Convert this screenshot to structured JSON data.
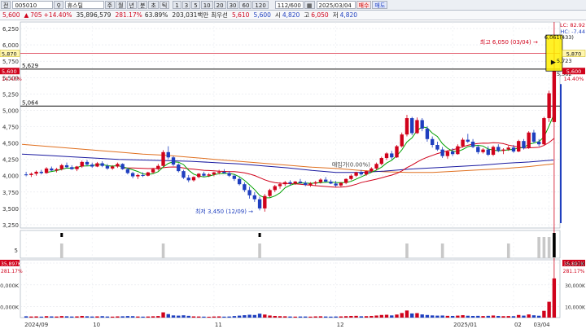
{
  "toolbar": {
    "period_label": "전",
    "code": "005010",
    "name": "휴스틸",
    "timeframes": [
      "주",
      "월",
      "년",
      "분",
      "초",
      "틱"
    ],
    "minute_steps": [
      "1",
      "3",
      "5",
      "10",
      "20",
      "30",
      "60",
      "120"
    ],
    "count": "112/600",
    "date": "2025/03/04",
    "buy_label": "매수",
    "sell_label": "매도"
  },
  "quote": {
    "price": "5,600",
    "change": "705",
    "change_pct": "+14.40%",
    "volume": "35,896,579",
    "vol_ratio": "281.17%",
    "turnover": "63.89%",
    "amount": "203,031백만",
    "priority_label": "최우선",
    "bid": "5,610",
    "ask": "5,600",
    "open_label": "시",
    "open": "4,820",
    "high_label": "고",
    "high": "6,050",
    "low_label": "저",
    "low": "4,820"
  },
  "colors": {
    "up": "#d0021b",
    "down": "#1f3fbf",
    "ma5": "#00a000",
    "ma20": "#d0021b",
    "ma60": "#1a1aa0",
    "ma120": "#e07020",
    "crosshair": "#d0021b",
    "highlight": "#ffee00"
  },
  "chart_data": {
    "type": "candlestick",
    "price_axis": {
      "ticks": [
        "6,250",
        "6,000",
        "5,750",
        "5,500",
        "5,250",
        "5,000",
        "4,750",
        "4,500",
        "4,250",
        "4,000",
        "3,750",
        "3,500",
        "3,250"
      ],
      "min": 3200,
      "max": 6350
    },
    "right_axis_labels": {
      "lc": "LC: 82.92",
      "hc": "HC: -7.44",
      "top_value": "5,870",
      "current_price": "5,600",
      "current_pct": "14.40%"
    },
    "left_axis_labels": {
      "top_value": "5,870",
      "current_price": "5,600",
      "current_pct": "14.40%"
    },
    "ref_lines": [
      {
        "label": "5,629",
        "value": 5629
      },
      {
        "label": "5,064",
        "value": 5064
      }
    ],
    "highs_marker": {
      "label": "최고 6,050 (03/04)",
      "value": 6050
    },
    "lows_marker": {
      "label": "최저 3,450 (12/09)",
      "value": 3450
    },
    "mid_annotation": "매입가(0.00%)",
    "magnifier_values": {
      "top": "6,061(433)",
      "mid": "5,723",
      "low": "5,562"
    },
    "candles": [
      [
        4020,
        4060,
        3990,
        4010
      ],
      [
        4010,
        4050,
        3980,
        4030
      ],
      [
        4030,
        4080,
        4000,
        4060
      ],
      [
        4060,
        4090,
        4020,
        4040
      ],
      [
        4040,
        4130,
        4030,
        4110
      ],
      [
        4110,
        4140,
        4070,
        4080
      ],
      [
        4080,
        4120,
        4050,
        4100
      ],
      [
        4100,
        4180,
        4080,
        4160
      ],
      [
        4160,
        4200,
        4110,
        4130
      ],
      [
        4130,
        4160,
        4090,
        4100
      ],
      [
        4100,
        4150,
        4070,
        4140
      ],
      [
        4140,
        4230,
        4120,
        4210
      ],
      [
        4210,
        4240,
        4150,
        4170
      ],
      [
        4170,
        4200,
        4120,
        4140
      ],
      [
        4140,
        4210,
        4130,
        4190
      ],
      [
        4190,
        4220,
        4130,
        4150
      ],
      [
        4150,
        4180,
        4090,
        4110
      ],
      [
        4110,
        4160,
        4090,
        4140
      ],
      [
        4140,
        4200,
        4120,
        4180
      ],
      [
        4180,
        4190,
        4090,
        4100
      ],
      [
        4100,
        4120,
        4020,
        4040
      ],
      [
        4040,
        4060,
        3960,
        3990
      ],
      [
        3990,
        4030,
        3950,
        4010
      ],
      [
        4010,
        4050,
        3980,
        4000
      ],
      [
        4000,
        4060,
        3990,
        4050
      ],
      [
        4050,
        4120,
        4030,
        4100
      ],
      [
        4100,
        4180,
        4080,
        4150
      ],
      [
        4150,
        4390,
        4140,
        4360
      ],
      [
        4360,
        4450,
        4250,
        4280
      ],
      [
        4280,
        4300,
        4150,
        4170
      ],
      [
        4170,
        4190,
        4050,
        4070
      ],
      [
        4070,
        4090,
        3950,
        3970
      ],
      [
        3970,
        4010,
        3900,
        3930
      ],
      [
        3930,
        3990,
        3910,
        3980
      ],
      [
        3980,
        4040,
        3960,
        4030
      ],
      [
        4030,
        4060,
        3980,
        4000
      ],
      [
        4000,
        4040,
        3980,
        4020
      ],
      [
        4020,
        4060,
        3990,
        4050
      ],
      [
        4050,
        4090,
        4020,
        4060
      ],
      [
        4060,
        4100,
        4030,
        4040
      ],
      [
        4040,
        4070,
        3980,
        4000
      ],
      [
        4000,
        4020,
        3920,
        3950
      ],
      [
        3950,
        3980,
        3850,
        3870
      ],
      [
        3870,
        3900,
        3750,
        3780
      ],
      [
        3780,
        3830,
        3650,
        3700
      ],
      [
        3700,
        3750,
        3600,
        3640
      ],
      [
        3640,
        3680,
        3470,
        3500
      ],
      [
        3500,
        3720,
        3450,
        3690
      ],
      [
        3690,
        3800,
        3670,
        3780
      ],
      [
        3780,
        3860,
        3750,
        3840
      ],
      [
        3840,
        3900,
        3800,
        3870
      ],
      [
        3870,
        3920,
        3840,
        3900
      ],
      [
        3900,
        3930,
        3850,
        3880
      ],
      [
        3880,
        3920,
        3860,
        3910
      ],
      [
        3910,
        3950,
        3880,
        3890
      ],
      [
        3890,
        3920,
        3840,
        3860
      ],
      [
        3860,
        3900,
        3830,
        3880
      ],
      [
        3880,
        3920,
        3850,
        3900
      ],
      [
        3900,
        3960,
        3880,
        3940
      ],
      [
        3940,
        3980,
        3900,
        3910
      ],
      [
        3910,
        3940,
        3870,
        3880
      ],
      [
        3880,
        3920,
        3830,
        3850
      ],
      [
        3850,
        3900,
        3830,
        3890
      ],
      [
        3890,
        3960,
        3870,
        3950
      ],
      [
        3950,
        4020,
        3930,
        4000
      ],
      [
        4000,
        4060,
        3980,
        4050
      ],
      [
        4050,
        4090,
        4000,
        4020
      ],
      [
        4020,
        4080,
        4000,
        4070
      ],
      [
        4070,
        4130,
        4050,
        4110
      ],
      [
        4110,
        4200,
        4090,
        4180
      ],
      [
        4180,
        4290,
        4160,
        4270
      ],
      [
        4270,
        4360,
        4240,
        4340
      ],
      [
        4340,
        4380,
        4250,
        4280
      ],
      [
        4280,
        4470,
        4270,
        4450
      ],
      [
        4450,
        4660,
        4430,
        4630
      ],
      [
        4630,
        4930,
        4600,
        4880
      ],
      [
        4880,
        4900,
        4620,
        4650
      ],
      [
        4650,
        4890,
        4640,
        4850
      ],
      [
        4850,
        4880,
        4680,
        4720
      ],
      [
        4720,
        4760,
        4520,
        4560
      ],
      [
        4560,
        4600,
        4430,
        4470
      ],
      [
        4470,
        4520,
        4380,
        4400
      ],
      [
        4400,
        4440,
        4270,
        4300
      ],
      [
        4300,
        4390,
        4260,
        4370
      ],
      [
        4370,
        4420,
        4300,
        4330
      ],
      [
        4330,
        4480,
        4320,
        4450
      ],
      [
        4450,
        4580,
        4430,
        4550
      ],
      [
        4550,
        4640,
        4500,
        4520
      ],
      [
        4520,
        4560,
        4420,
        4440
      ],
      [
        4440,
        4470,
        4330,
        4360
      ],
      [
        4360,
        4420,
        4340,
        4400
      ],
      [
        4400,
        4450,
        4300,
        4320
      ],
      [
        4320,
        4460,
        4300,
        4440
      ],
      [
        4440,
        4480,
        4360,
        4380
      ],
      [
        4380,
        4420,
        4330,
        4400
      ],
      [
        4400,
        4460,
        4380,
        4430
      ],
      [
        4430,
        4470,
        4350,
        4370
      ],
      [
        4370,
        4550,
        4360,
        4530
      ],
      [
        4530,
        4560,
        4400,
        4420
      ],
      [
        4420,
        4680,
        4410,
        4660
      ],
      [
        4660,
        4700,
        4500,
        4520
      ],
      [
        4520,
        4560,
        4450,
        4480
      ],
      [
        4480,
        4900,
        4470,
        4880
      ],
      [
        4880,
        5300,
        4820,
        5260
      ],
      [
        4820,
        6050,
        4820,
        5600
      ]
    ],
    "ma_lines": [
      {
        "key": "ma5"
      },
      {
        "key": "ma20"
      },
      {
        "key": "ma60",
        "values": [
          4330,
          4310,
          4290,
          4270,
          4250,
          4240,
          4230,
          4220,
          4200,
          4180,
          4150,
          4120,
          4080,
          4050,
          4050,
          4070,
          4100,
          4120,
          4140,
          4160,
          4190,
          4210,
          4240
        ]
      },
      {
        "key": "ma120",
        "values": [
          4480,
          4450,
          4420,
          4390,
          4360,
          4330,
          4310,
          4280,
          4250,
          4220,
          4190,
          4160,
          4130,
          4110,
          4080,
          4060,
          4050,
          4050,
          4070,
          4090,
          4110,
          4140,
          4180
        ]
      }
    ],
    "x_axis_ticks": [
      "2024/09",
      "10",
      "11",
      "12",
      "2025/01",
      "02",
      "03/04"
    ],
    "indicator": {
      "label": "5",
      "signal_bars": [
        0,
        0,
        0,
        0,
        0,
        0,
        0,
        0,
        0,
        0,
        0,
        0,
        0,
        0,
        0,
        0,
        0,
        0,
        0,
        0,
        0,
        0,
        0,
        0,
        0,
        0,
        0,
        0,
        0,
        0,
        0,
        0,
        0,
        0,
        0,
        0,
        0,
        0,
        0,
        0,
        0,
        0,
        0,
        0,
        0,
        0,
        0,
        0,
        0,
        0,
        0,
        0,
        0,
        0,
        0,
        0,
        0,
        0,
        0,
        0,
        0,
        0,
        0,
        0,
        0,
        0,
        0,
        0,
        0,
        0,
        0,
        0,
        0,
        0,
        0,
        0,
        0,
        0,
        0,
        0,
        0,
        0,
        0,
        0,
        0,
        0,
        0,
        0,
        0,
        0,
        0,
        0,
        0,
        0,
        0,
        0,
        0,
        0,
        0,
        0,
        0,
        0,
        0,
        1,
        2
      ],
      "sell_flags": [
        7,
        46,
        104
      ]
    },
    "volume_axis": {
      "ticks": [
        "50,000K",
        "30,000K",
        "10,000K"
      ],
      "top_label": "35,897K",
      "pct_label": "281.17%"
    },
    "volume": [
      1.2,
      1.0,
      1.1,
      0.9,
      1.3,
      1.1,
      1.0,
      1.4,
      1.2,
      1.0,
      1.1,
      1.5,
      1.2,
      1.0,
      1.1,
      1.3,
      1.0,
      0.9,
      1.1,
      1.2,
      1.4,
      1.3,
      1.0,
      0.9,
      1.0,
      1.2,
      1.4,
      4.8,
      3.2,
      2.0,
      1.8,
      2.1,
      1.6,
      1.1,
      1.0,
      0.9,
      0.8,
      1.0,
      1.1,
      0.9,
      1.0,
      1.4,
      1.8,
      2.2,
      2.6,
      2.4,
      3.6,
      2.8,
      1.9,
      1.5,
      1.3,
      1.2,
      1.0,
      0.9,
      1.0,
      1.0,
      0.9,
      1.1,
      1.2,
      1.0,
      0.9,
      1.0,
      1.1,
      1.3,
      1.5,
      1.6,
      1.2,
      1.3,
      1.5,
      1.9,
      2.4,
      2.6,
      2.0,
      2.8,
      4.2,
      6.5,
      3.8,
      4.1,
      2.9,
      2.4,
      2.0,
      1.8,
      1.9,
      1.6,
      1.5,
      1.8,
      2.2,
      1.7,
      1.5,
      1.6,
      1.4,
      1.6,
      1.9,
      1.5,
      1.3,
      1.4,
      1.3,
      2.4,
      1.8,
      2.9,
      2.1,
      1.7,
      6.2,
      14.5,
      35.9
    ]
  }
}
